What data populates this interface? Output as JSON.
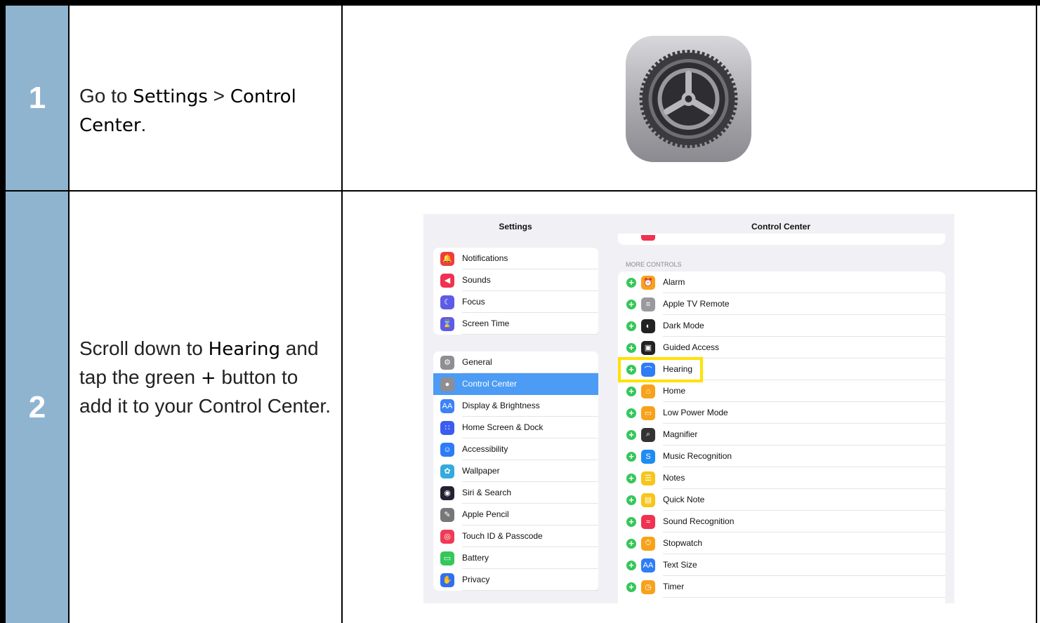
{
  "steps": [
    {
      "number": "1",
      "text_prefix": "Go to ",
      "settings": "Settings",
      "sep": " > ",
      "control_center": "Control Center",
      "suffix": "."
    },
    {
      "number": "2",
      "text_1": "Scroll down to ",
      "hearing": "Hearing",
      "text_2": " and tap the green ",
      "plus": "+",
      "text_3": " button to add it to your Control Center."
    }
  ],
  "ipad": {
    "left_title": "Settings",
    "right_title": "Control Center",
    "section_header": "MORE CONTROLS",
    "settings_group1": [
      {
        "label": "Notifications",
        "icon": "bell-icon",
        "color": "#f23c3c"
      },
      {
        "label": "Sounds",
        "icon": "speaker-icon",
        "color": "#f0314f"
      },
      {
        "label": "Focus",
        "icon": "moon-icon",
        "color": "#5d5ce6"
      },
      {
        "label": "Screen Time",
        "icon": "hourglass-icon",
        "color": "#5d5ce6"
      }
    ],
    "settings_group2": [
      {
        "label": "General",
        "icon": "gear-icon",
        "color": "#8e8e93"
      },
      {
        "label": "Control Center",
        "icon": "toggle-icon",
        "color": "#8e8e93",
        "selected": true
      },
      {
        "label": "Display & Brightness",
        "icon": "aa-icon",
        "color": "#3c82f6"
      },
      {
        "label": "Home Screen & Dock",
        "icon": "grid-icon",
        "color": "#3c5cf0"
      },
      {
        "label": "Accessibility",
        "icon": "accessibility-icon",
        "color": "#2d7cf6"
      },
      {
        "label": "Wallpaper",
        "icon": "flower-icon",
        "color": "#35aadc"
      },
      {
        "label": "Siri & Search",
        "icon": "siri-icon",
        "color": "#222233"
      },
      {
        "label": "Apple Pencil",
        "icon": "pencil-icon",
        "color": "#777779"
      },
      {
        "label": "Touch ID & Passcode",
        "icon": "fingerprint-icon",
        "color": "#f03a55"
      },
      {
        "label": "Battery",
        "icon": "battery-icon",
        "color": "#34c759"
      },
      {
        "label": "Privacy",
        "icon": "hand-icon",
        "color": "#2f6ff0"
      }
    ],
    "controls": [
      {
        "label": "Alarm",
        "icon": "alarm-icon",
        "color": "#f7a21b"
      },
      {
        "label": "Apple TV Remote",
        "icon": "remote-icon",
        "color": "#9a9a9e"
      },
      {
        "label": "Dark Mode",
        "icon": "dark-mode-icon",
        "color": "#222222"
      },
      {
        "label": "Guided Access",
        "icon": "lock-icon",
        "color": "#222222"
      },
      {
        "label": "Hearing",
        "icon": "ear-icon",
        "color": "#2f7df6"
      },
      {
        "label": "Home",
        "icon": "house-icon",
        "color": "#f7a21b"
      },
      {
        "label": "Low Power Mode",
        "icon": "battery-icon",
        "color": "#f7a21b"
      },
      {
        "label": "Magnifier",
        "icon": "magnifier-icon",
        "color": "#333333"
      },
      {
        "label": "Music Recognition",
        "icon": "shazam-icon",
        "color": "#1e8cf0"
      },
      {
        "label": "Notes",
        "icon": "notes-icon",
        "color": "#f7c51b"
      },
      {
        "label": "Quick Note",
        "icon": "quick-note-icon",
        "color": "#f7c51b"
      },
      {
        "label": "Sound Recognition",
        "icon": "sound-wave-icon",
        "color": "#f0314f"
      },
      {
        "label": "Stopwatch",
        "icon": "stopwatch-icon",
        "color": "#f7a21b"
      },
      {
        "label": "Text Size",
        "icon": "text-size-icon",
        "color": "#2f7df6"
      },
      {
        "label": "Timer",
        "icon": "timer-icon",
        "color": "#f7a21b"
      }
    ]
  }
}
